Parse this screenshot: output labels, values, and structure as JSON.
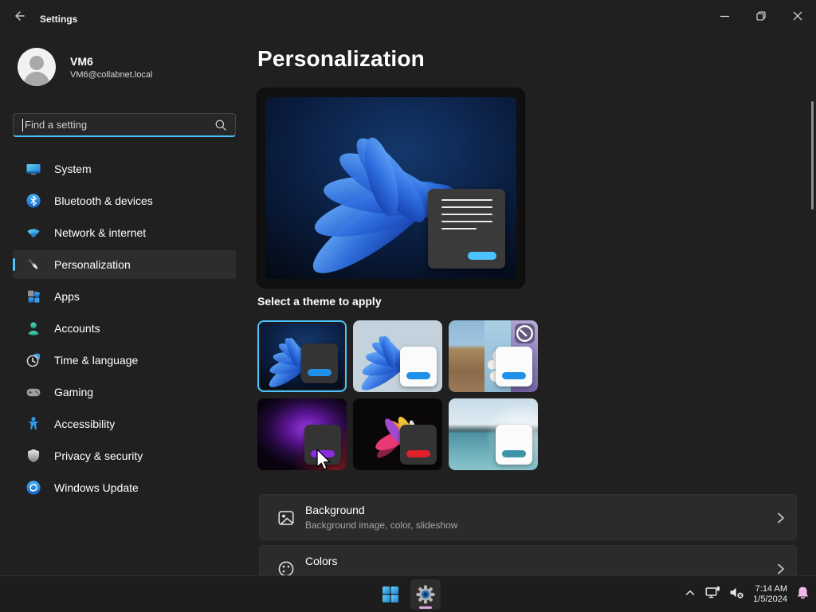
{
  "colors": {
    "accent": "#4cc2ff",
    "taskbar_active_indicator": "#dda8de",
    "notification_bell": "#f2b8ec"
  },
  "titlebar": {
    "title": "Settings"
  },
  "user": {
    "name": "VM6",
    "email": "VM6@collabnet.local"
  },
  "search": {
    "placeholder": "Find a setting"
  },
  "sidebar": {
    "items": [
      {
        "label": "System",
        "icon": "system-icon",
        "selected": false
      },
      {
        "label": "Bluetooth & devices",
        "icon": "bluetooth-icon",
        "selected": false
      },
      {
        "label": "Network & internet",
        "icon": "network-icon",
        "selected": false
      },
      {
        "label": "Personalization",
        "icon": "personalization-icon",
        "selected": true
      },
      {
        "label": "Apps",
        "icon": "apps-icon",
        "selected": false
      },
      {
        "label": "Accounts",
        "icon": "accounts-icon",
        "selected": false
      },
      {
        "label": "Time & language",
        "icon": "time-language-icon",
        "selected": false
      },
      {
        "label": "Gaming",
        "icon": "gaming-icon",
        "selected": false
      },
      {
        "label": "Accessibility",
        "icon": "accessibility-icon",
        "selected": false
      },
      {
        "label": "Privacy & security",
        "icon": "privacy-security-icon",
        "selected": false
      },
      {
        "label": "Windows Update",
        "icon": "windows-update-icon",
        "selected": false
      }
    ]
  },
  "main": {
    "page_title": "Personalization",
    "theme_section_label": "Select a theme to apply",
    "themes": [
      {
        "name": "dark-bloom",
        "selected": true,
        "card": "dark",
        "button_color": "#1e90e8"
      },
      {
        "name": "light-bloom",
        "selected": false,
        "card": "light",
        "button_color": "#1e90e8"
      },
      {
        "name": "landscape-collage",
        "selected": false,
        "card": "light",
        "button_color": "#1e90e8",
        "badge": "slideshow-badge"
      },
      {
        "name": "purple-glow",
        "selected": false,
        "card": "dark",
        "button_color": "#8a2be2"
      },
      {
        "name": "abstract-flower",
        "selected": false,
        "card": "dark",
        "button_color": "#e01f28"
      },
      {
        "name": "calm-lake",
        "selected": false,
        "card": "light",
        "button_color": "#3d93a8"
      }
    ],
    "rows": [
      {
        "title": "Background",
        "subtitle": "Background image, color, slideshow"
      },
      {
        "title": "Colors",
        "subtitle": ""
      }
    ]
  },
  "taskbar": {
    "time": "7:14 AM",
    "date": "1/5/2024"
  }
}
